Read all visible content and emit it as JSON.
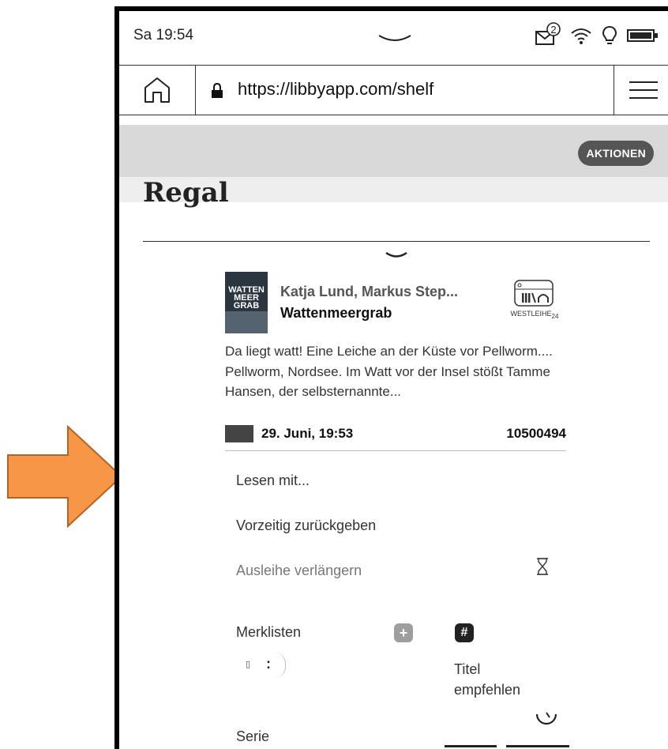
{
  "status_bar": {
    "time": "Sa 19:54",
    "notification_count": "2",
    "icons": [
      "chevron-down-icon",
      "mail-icon",
      "wifi-icon",
      "bulb-icon",
      "battery-icon"
    ]
  },
  "browser": {
    "url": "https://libbyapp.com/shelf",
    "icons": [
      "home-icon",
      "lock-icon",
      "hamburger-menu-icon"
    ]
  },
  "toolbar": {
    "actions_label": "AKTIONEN"
  },
  "page": {
    "title": "Regal"
  },
  "loan": {
    "author": "Katja Lund, Markus Step...",
    "title": "Wattenmeergrab",
    "cover_text": [
      "WATTEN",
      "MEER",
      "GRAB"
    ],
    "library_name": "WESTLEIHE",
    "library_suffix": "24",
    "description": "Da liegt watt! Eine Leiche an der Küste vor Pellworm.... Pellworm, Nordsee. Im Watt vor der Insel stößt Tamme Hansen, der selbsternannte...",
    "due_date": "29. Juni, 19:53",
    "loan_id": "10500494"
  },
  "menu": {
    "read_with": "Lesen mit...",
    "return_early": "Vorzeitig zurückgeben",
    "renew": "Ausleihe verlängern",
    "lists": "Merklisten",
    "recommend_line1": "Titel",
    "recommend_line2": "empfehlen",
    "series": "Serie"
  },
  "colors": {
    "arrow": "#f79646",
    "arrow_outline": "#b36424",
    "toolbar_bg": "#d9d9d9",
    "pill_bg": "#555555"
  }
}
